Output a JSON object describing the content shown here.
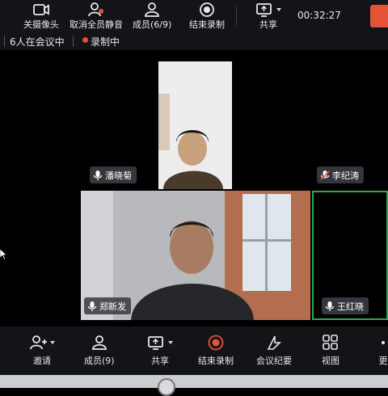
{
  "toolbar": {
    "camera_label": "关摄像头",
    "unmute_all_label": "取消全员静音",
    "members_label": "成员(6/9)",
    "end_record_label": "结束录制",
    "share_label": "共享",
    "timer": "00:32:27"
  },
  "status": {
    "participants_text": "6人在会议中",
    "recording_text": "录制中"
  },
  "tiles": {
    "pan": "潘晓菊",
    "li": "李纪涛",
    "zheng": "郑新发",
    "wang": "王红晓"
  },
  "bottom": {
    "invite_label": "邀请",
    "members_label": "成员(9)",
    "share_label": "共享",
    "end_record_label": "结束录制",
    "minutes_label": "会议纪要",
    "view_label": "视图",
    "more_label": "更"
  },
  "colors": {
    "accent_red": "#e5533b",
    "active_border": "#2fa84f",
    "bar_bg": "#121418"
  }
}
